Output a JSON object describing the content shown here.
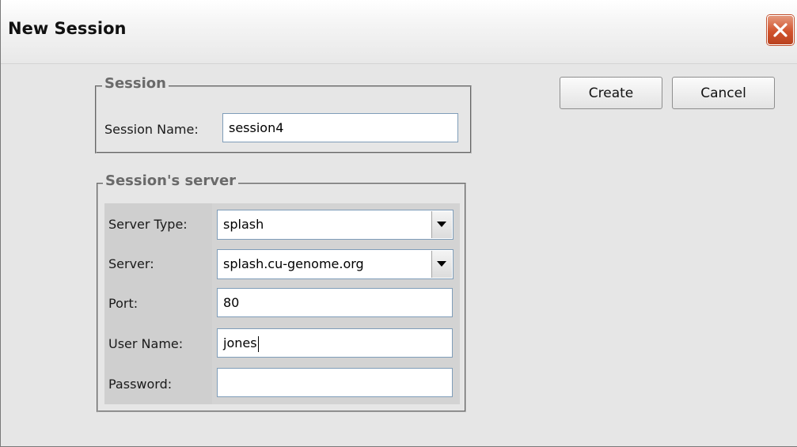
{
  "window": {
    "title": "New Session"
  },
  "session_group": {
    "legend": "Session",
    "session_name_label": "Session Name:",
    "session_name_value": "session4"
  },
  "server_group": {
    "legend": "Session's server",
    "server_type_label": "Server Type:",
    "server_type_value": "splash",
    "server_label": "Server:",
    "server_value": "splash.cu-genome.org",
    "port_label": "Port:",
    "port_value": "80",
    "user_name_label": "User Name:",
    "user_name_value": "jones",
    "password_label": "Password:",
    "password_value": ""
  },
  "buttons": {
    "create": "Create",
    "cancel": "Cancel"
  },
  "icons": {
    "close": "close-icon",
    "dropdown": "chevron-down-icon"
  },
  "colors": {
    "close_button": "#d1532d",
    "window_bg": "#e6e6e6"
  }
}
